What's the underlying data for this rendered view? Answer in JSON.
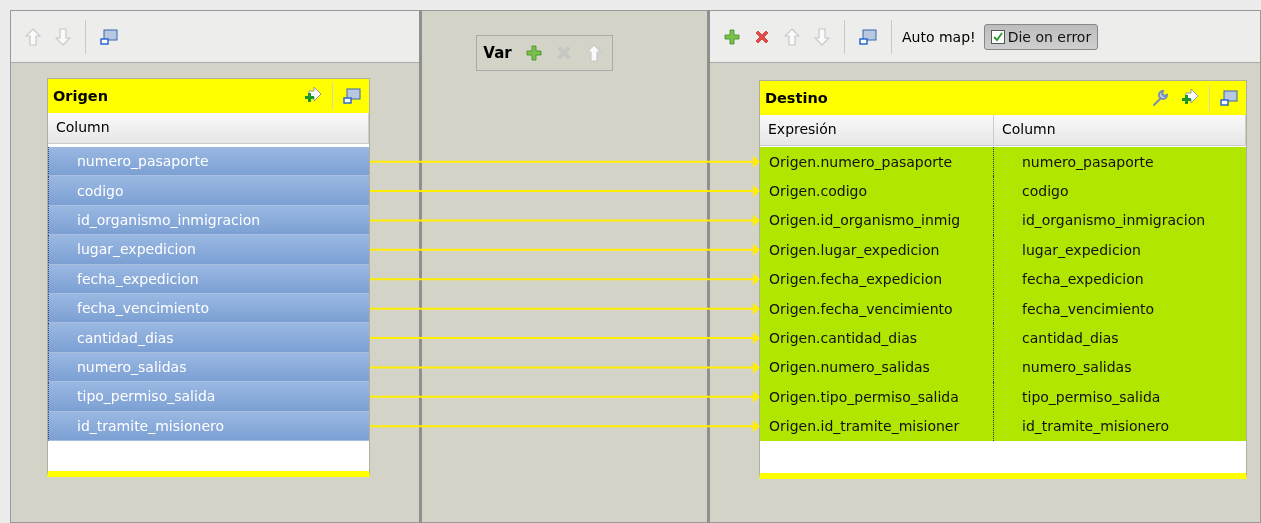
{
  "input_toolbar": [
    {
      "kind": "up",
      "disabled": true
    },
    {
      "kind": "down",
      "disabled": true
    },
    {
      "kind": "separator",
      "disabled": false
    },
    {
      "kind": "window",
      "disabled": false
    }
  ],
  "input_table": {
    "title": "Origen",
    "header_tools": [
      {
        "kind": "add-arrow"
      },
      {
        "kind": "separator"
      },
      {
        "kind": "window"
      }
    ],
    "columns": [
      "Column"
    ],
    "rows": [
      "numero_pasaporte",
      "codigo",
      "id_organismo_inmigracion",
      "lugar_expedicion",
      "fecha_expedicion",
      "fecha_vencimiento",
      "cantidad_dias",
      "numero_salidas",
      "tipo_permiso_salida",
      "id_tramite_misionero"
    ]
  },
  "var_panel": {
    "title": "Var",
    "tools": [
      {
        "kind": "add",
        "disabled": false
      },
      {
        "kind": "delete",
        "disabled": true
      },
      {
        "kind": "up",
        "disabled": true
      }
    ]
  },
  "output_toolbar": {
    "tools": [
      {
        "kind": "add",
        "disabled": false
      },
      {
        "kind": "delete",
        "disabled": false
      },
      {
        "kind": "up",
        "disabled": true
      },
      {
        "kind": "down",
        "disabled": true
      },
      {
        "kind": "separator",
        "disabled": false
      },
      {
        "kind": "window",
        "disabled": false
      },
      {
        "kind": "separator",
        "disabled": false
      }
    ],
    "auto_map": "Auto map!",
    "die_on_error": {
      "label": "Die on error",
      "checked": true
    }
  },
  "output_table": {
    "title": "Destino",
    "header_tools": [
      {
        "kind": "wrench"
      },
      {
        "kind": "add-arrow"
      },
      {
        "kind": "separator"
      },
      {
        "kind": "window"
      }
    ],
    "columns": [
      "Expresión",
      "Column"
    ],
    "rows": [
      {
        "expression": "Origen.numero_pasaporte",
        "column": "numero_pasaporte"
      },
      {
        "expression": "Origen.codigo",
        "column": "codigo"
      },
      {
        "expression": "Origen.id_organismo_inmig",
        "column": "id_organismo_inmigracion"
      },
      {
        "expression": "Origen.lugar_expedicion",
        "column": "lugar_expedicion"
      },
      {
        "expression": "Origen.fecha_expedicion",
        "column": "fecha_expedicion"
      },
      {
        "expression": "Origen.fecha_vencimiento",
        "column": "fecha_vencimiento"
      },
      {
        "expression": "Origen.cantidad_dias",
        "column": "cantidad_dias"
      },
      {
        "expression": "Origen.numero_salidas",
        "column": "numero_salidas"
      },
      {
        "expression": "Origen.tipo_permiso_salida",
        "column": "tipo_permiso_salida"
      },
      {
        "expression": "Origen.id_tramite_misioner",
        "column": "id_tramite_misionero"
      }
    ]
  }
}
